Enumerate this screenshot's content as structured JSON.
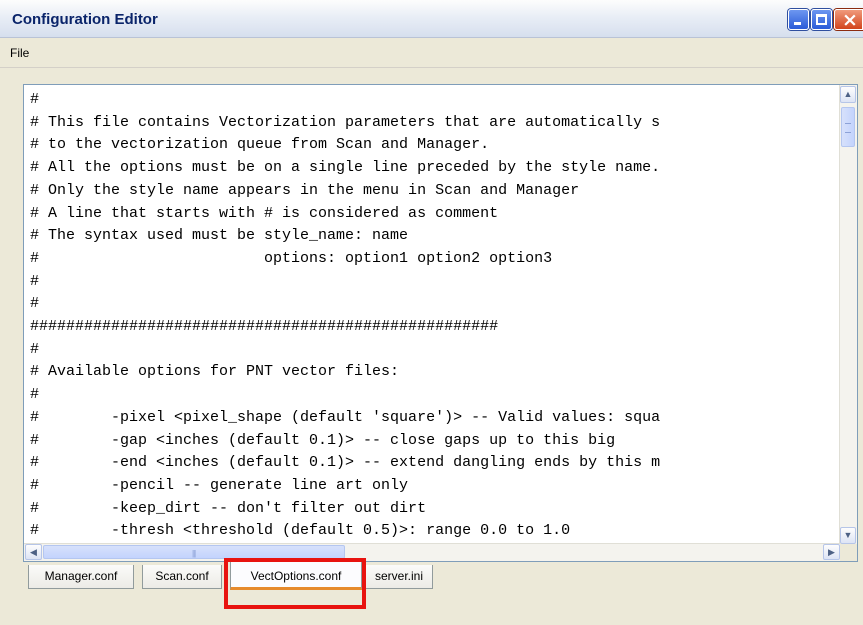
{
  "window": {
    "title": "Configuration Editor",
    "controls": {
      "minimize_icon": "minimize-icon",
      "maximize_icon": "maximize-icon",
      "close_icon": "close-icon"
    }
  },
  "menu": {
    "file_label": "File"
  },
  "editor": {
    "content": "#\n# This file contains Vectorization parameters that are automatically s\n# to the vectorization queue from Scan and Manager.\n# All the options must be on a single line preceded by the style name.\n# Only the style name appears in the menu in Scan and Manager\n# A line that starts with # is considered as comment\n# The syntax used must be style_name: name\n#                         options: option1 option2 option3\n#\n#\n####################################################\n#\n# Available options for PNT vector files:\n#\n#        -pixel <pixel_shape (default 'square')> -- Valid values: squa\n#        -gap <inches (default 0.1)> -- close gaps up to this big\n#        -end <inches (default 0.1)> -- extend dangling ends by this m\n#        -pencil -- generate line art only\n#        -keep_dirt -- don't filter out dirt\n#        -thresh <threshold (default 0.5)>: range 0.0 to 1.0",
    "scroll_up_glyph": "▲",
    "scroll_down_glyph": "▼",
    "scroll_left_glyph": "◀",
    "scroll_right_glyph": "▶",
    "h_grip_glyph": "|||"
  },
  "tabs": [
    {
      "label": "Manager.conf",
      "active": false
    },
    {
      "label": "Scan.conf",
      "active": false
    },
    {
      "label": "VectOptions.conf",
      "active": true
    },
    {
      "label": "server.ini",
      "active": false
    }
  ],
  "colors": {
    "title_text": "#0a246a",
    "active_tab_underline": "#e68b2c",
    "highlight_box": "#e8130f"
  }
}
